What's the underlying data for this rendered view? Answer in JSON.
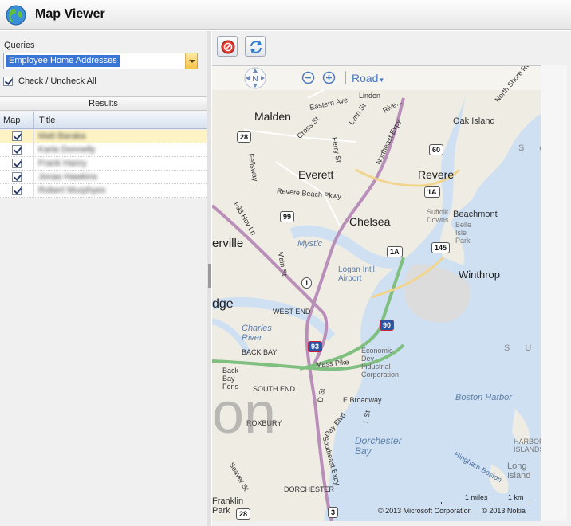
{
  "app": {
    "title": "Map Viewer"
  },
  "queries": {
    "label": "Queries",
    "selected": "Employee Home Addresses",
    "check_all_label": "Check / Uncheck All",
    "check_all_checked": true
  },
  "results": {
    "header": "Results",
    "columns": {
      "map": "Map",
      "title": "Title"
    },
    "rows": [
      {
        "title": "Matt Baraka",
        "checked": true,
        "selected": true
      },
      {
        "title": "Karla Donnelly",
        "checked": true,
        "selected": false
      },
      {
        "title": "Frank Hanry",
        "checked": true,
        "selected": false
      },
      {
        "title": "Jonas Hawkins",
        "checked": true,
        "selected": false
      },
      {
        "title": "Robert Murphyes",
        "checked": true,
        "selected": false
      }
    ]
  },
  "toolbar": {
    "clear_icon": "clear-icon",
    "refresh_icon": "refresh-icon"
  },
  "map": {
    "pan_north": "N",
    "map_type": "Road",
    "copyright": "© 2013 Microsoft Corporation     © 2013 Nokia",
    "scale_miles": "1 miles",
    "scale_km": "1 km",
    "watermark": "on",
    "labels": {
      "malden": "Malden",
      "everett": "Everett",
      "revere": "Revere",
      "chelsea": "Chelsea",
      "winthrop": "Winthrop",
      "somerville": "erville",
      "cambridge": "dge",
      "oak_island": "Oak Island",
      "beachmont": "Beachmont",
      "suffolk_downs": "Suffolk\nDowns",
      "belle_isle_park": "Belle\nIsle\nPark",
      "logan": "Logan Int'l\nAirport",
      "mystic": "Mystic",
      "charles_river": "Charles\nRiver",
      "west_end": "WEST END",
      "back_bay": "BACK BAY",
      "back_bay_fens": "Back\nBay\nFens",
      "south_end": "SOUTH END",
      "roxbury": "ROXBURY",
      "dorchester": "DORCHESTER",
      "econ_dev": "Economic\nDev\nIndustrial\nCorporation",
      "boston_harbor": "Boston Harbor",
      "dorchester_bay": "Dorchester\nBay",
      "harbor_islands": "HARBOR\nISLANDS",
      "long_island": "Long\nIsland",
      "franklin_park": "Franklin\nPark",
      "eastern_ave": "Eastern Ave",
      "linden": "Linden",
      "cross_st": "Cross St",
      "lynn_st": "Lynn St",
      "ferry_st": "Ferry St",
      "fellsway": "Fellsway",
      "revere_beach_pkwy": "Revere Beach Pkwy",
      "main_st": "Main St",
      "mass_pike": "Mass Pike",
      "e_broadway": "E Broadway",
      "d_st": "D St",
      "l_st": "L St",
      "day_blvd": "Day Blvd",
      "southeast_expy": "Southeast Expy",
      "northeast_expy": "Northeast Expy",
      "i93_hov": "I-93 Hov Ln",
      "seaver_st": "Seaver St",
      "north_shore_rd": "North Shore Rd",
      "hingham_boston": "Hingham-Boston",
      "riverside": "Rive...",
      "sua": "S U F",
      "so": "S o"
    },
    "shields": {
      "r28_top": "28",
      "r60": "60",
      "r1a_top": "1A",
      "r99": "99",
      "r1a_mid": "1A",
      "r145": "145",
      "r1": "1",
      "i93": "93",
      "i90": "90",
      "r28_bot": "28",
      "r3": "3"
    }
  }
}
